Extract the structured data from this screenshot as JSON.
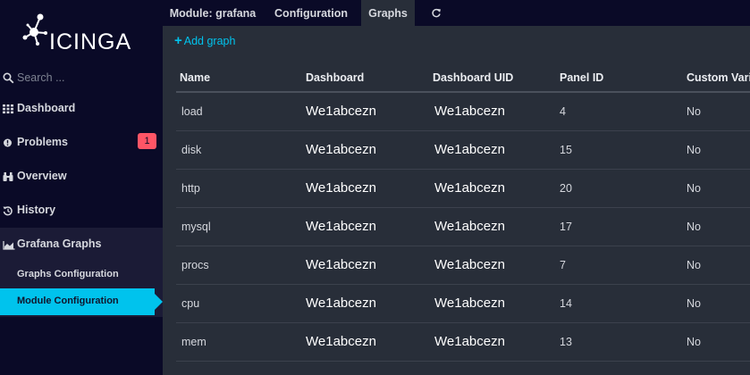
{
  "logo": {
    "text": "ICINGA"
  },
  "search": {
    "placeholder": "Search ..."
  },
  "nav": {
    "dashboard": "Dashboard",
    "problems": "Problems",
    "problems_count": "1",
    "overview": "Overview",
    "history": "History",
    "grafana_graphs": "Grafana Graphs",
    "graphs_configuration": "Graphs Configuration",
    "module_configuration": "Module Configuration"
  },
  "tabs": {
    "module": "Module: grafana",
    "configuration": "Configuration",
    "graphs": "Graphs"
  },
  "actions": {
    "add_graph": "Add graph"
  },
  "table": {
    "headers": [
      "Name",
      "Dashboard",
      "Dashboard UID",
      "Panel ID",
      "Custom Variables"
    ],
    "rows": [
      {
        "name": "load",
        "dashboard": "We1abcezn",
        "uid": "We1abcezn",
        "panel": "4",
        "custom": "No"
      },
      {
        "name": "disk",
        "dashboard": "We1abcezn",
        "uid": "We1abcezn",
        "panel": "15",
        "custom": "No"
      },
      {
        "name": "http",
        "dashboard": "We1abcezn",
        "uid": "We1abcezn",
        "panel": "20",
        "custom": "No"
      },
      {
        "name": "mysql",
        "dashboard": "We1abcezn",
        "uid": "We1abcezn",
        "panel": "17",
        "custom": "No"
      },
      {
        "name": "procs",
        "dashboard": "We1abcezn",
        "uid": "We1abcezn",
        "panel": "7",
        "custom": "No"
      },
      {
        "name": "cpu",
        "dashboard": "We1abcezn",
        "uid": "We1abcezn",
        "panel": "14",
        "custom": "No"
      },
      {
        "name": "mem",
        "dashboard": "We1abcezn",
        "uid": "We1abcezn",
        "panel": "13",
        "custom": "No"
      }
    ]
  },
  "colors": {
    "accent": "#00c3ed",
    "sidebar": "#0a0a27",
    "content": "#282e39",
    "badge": "#ff5566"
  }
}
